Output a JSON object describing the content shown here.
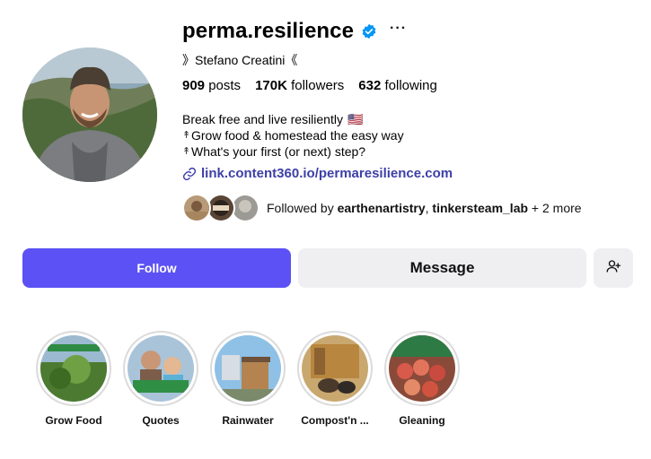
{
  "profile": {
    "username": "perma.resilience",
    "verified_icon": "verified-badge-icon",
    "more_label": "···",
    "full_name": "》Stefano Creatini《",
    "avatar_icon": "profile-photo"
  },
  "stats": {
    "posts_count": "909",
    "posts_label": "posts",
    "followers_count": "170K",
    "followers_label": "followers",
    "following_count": "632",
    "following_label": "following"
  },
  "bio": {
    "line1": "Break free and live resiliently",
    "line1_emoji": "🇺🇸",
    "line2_prefix": "↟",
    "line2": "Grow food & homestead the easy way",
    "line3_prefix": "↟",
    "line3": "What's your first (or next) step?"
  },
  "link": {
    "icon": "link-icon",
    "text": "link.content360.io/permaresilience.com"
  },
  "followed_by": {
    "prefix": "Followed by",
    "user1": "earthenartistry",
    "separator": ",",
    "user2": "tinkersteam_lab",
    "suffix": "+ 2 more"
  },
  "actions": {
    "follow_label": "Follow",
    "message_label": "Message",
    "add_user_icon": "add-user-icon"
  },
  "highlights": [
    {
      "label": "Grow Food"
    },
    {
      "label": "Quotes"
    },
    {
      "label": "Rainwater"
    },
    {
      "label": "Compost'n ..."
    },
    {
      "label": "Gleaning"
    }
  ],
  "colors": {
    "follow_button": "#5b51f5",
    "secondary_button": "#efeff2",
    "link_text": "#3d3fa8",
    "verified_blue": "#0095f6"
  }
}
